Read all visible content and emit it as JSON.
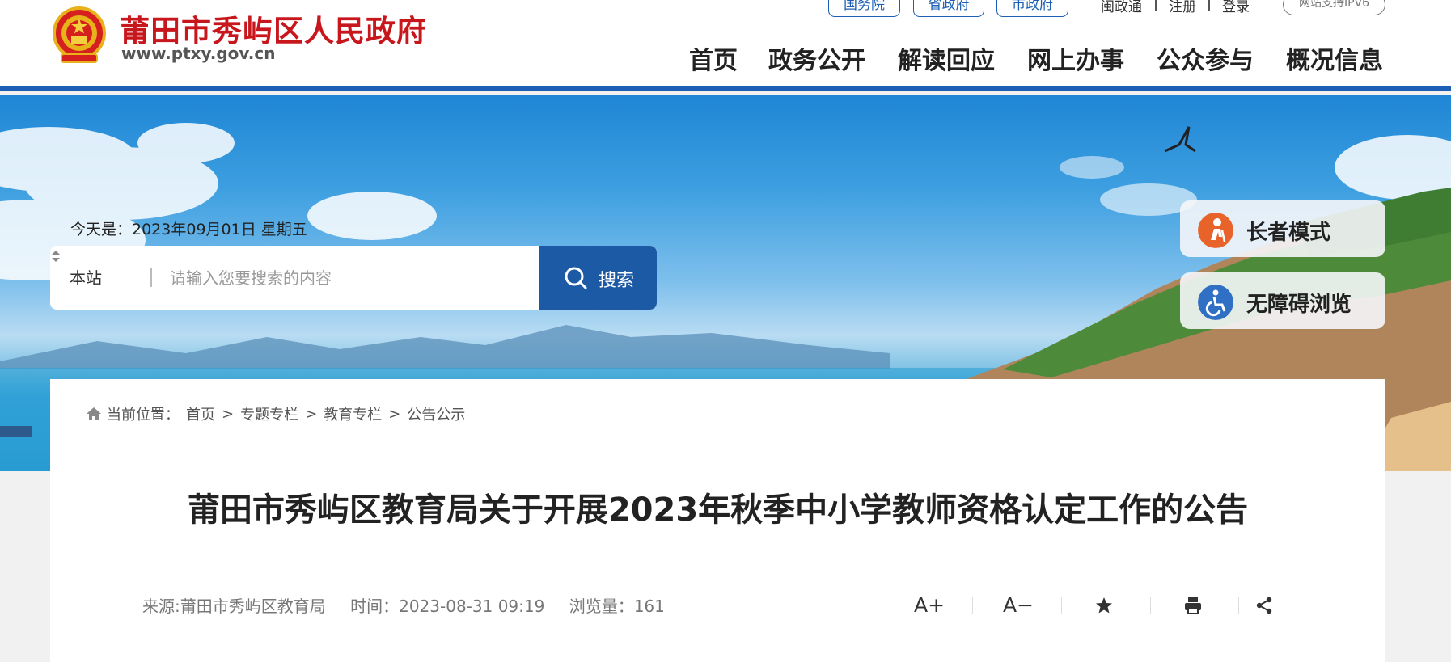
{
  "header": {
    "site_name": "莆田市秀屿区人民政府",
    "site_url": "www.ptxy.gov.cn",
    "top_pills": [
      "国务院",
      "省政府",
      "市政府"
    ],
    "top_links": [
      "闽政通",
      "注册",
      "登录"
    ],
    "ipv6_badge": "网站支持IPV6",
    "nav": [
      "首页",
      "政务公开",
      "解读回应",
      "网上办事",
      "公众参与",
      "概况信息"
    ]
  },
  "banner": {
    "date_text": "今天是：2023年09月01日 星期五",
    "search": {
      "scope": "本站",
      "placeholder": "请输入您要搜索的内容",
      "button": "搜索"
    },
    "modes": [
      "长者模式",
      "无障碍浏览"
    ]
  },
  "article": {
    "breadcrumb_label": "当前位置：",
    "breadcrumb": [
      "首页",
      "专题专栏",
      "教育专栏",
      "公告公示"
    ],
    "title": "莆田市秀屿区教育局关于开展2023年秋季中小学教师资格认定工作的公告",
    "source": "来源:莆田市秀屿区教育局",
    "time": "时间：2023-08-31 09:19",
    "views": "浏览量：161",
    "tools": [
      "A+",
      "A−"
    ]
  },
  "colors": {
    "brand_blue": "#1c5fb4",
    "title_red": "#c8161d",
    "search_button": "#1c5aa6",
    "elder_icon": "#e8632a",
    "accessible_icon": "#2f6fc4"
  },
  "icons": [
    "national-emblem-icon",
    "search-icon",
    "sort-arrows-icon",
    "elder-icon",
    "wheelchair-icon",
    "home-icon",
    "star-icon",
    "print-icon",
    "share-icon"
  ]
}
